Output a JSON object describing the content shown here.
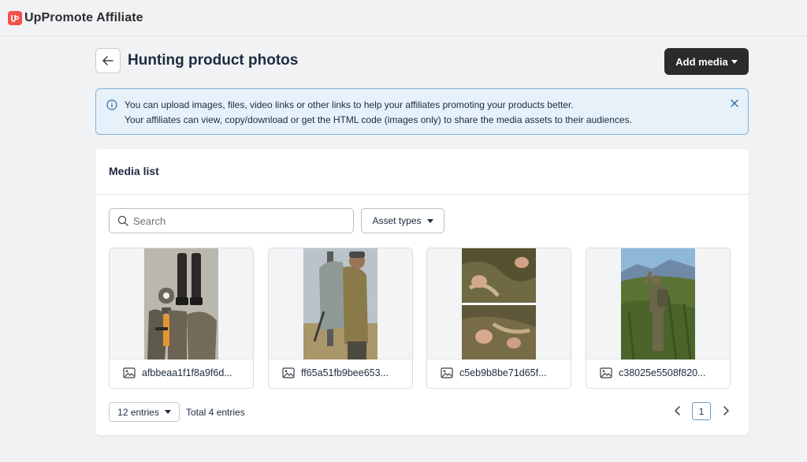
{
  "app": {
    "title": "UpPromote Affiliate",
    "logo_icon": "uppromote-logo-icon",
    "brand_color": "#f0524a"
  },
  "header": {
    "back_icon": "arrow-left-icon",
    "title": "Hunting product photos",
    "add_media_label": "Add media"
  },
  "banner": {
    "line1": "You can upload images, files, video links or other links to help your affiliates promoting your products better.",
    "line2": "Your affiliates can view, copy/download or get the HTML code (images only) to share the media assets to their audiences.",
    "info_icon": "info-circle-icon",
    "close_icon": "close-icon",
    "background": "#e6f1f9",
    "border": "#7fb2d8"
  },
  "media_list": {
    "title": "Media list",
    "search": {
      "placeholder": "Search",
      "value": ""
    },
    "asset_types_label": "Asset types",
    "items": [
      {
        "name": "afbbeaa1f1f8a9f6d...",
        "photo": "hunting boots and camouflage gear flat lay",
        "icon": "image-icon"
      },
      {
        "name": "ff65a51fb9bee653...",
        "photo": "hunter with large backpack",
        "icon": "image-icon"
      },
      {
        "name": "c5eb9b8be71d65f...",
        "photo": "hands adjusting camouflage strap",
        "icon": "image-icon"
      },
      {
        "name": "c38025e5508f820...",
        "photo": "hunter in camouflage overlooking valley",
        "icon": "image-icon"
      }
    ]
  },
  "footer": {
    "entries_label": "12 entries",
    "total_label": "Total 4 entries",
    "current_page": "1",
    "prev_icon": "chevron-left-icon",
    "next_icon": "chevron-right-icon"
  }
}
